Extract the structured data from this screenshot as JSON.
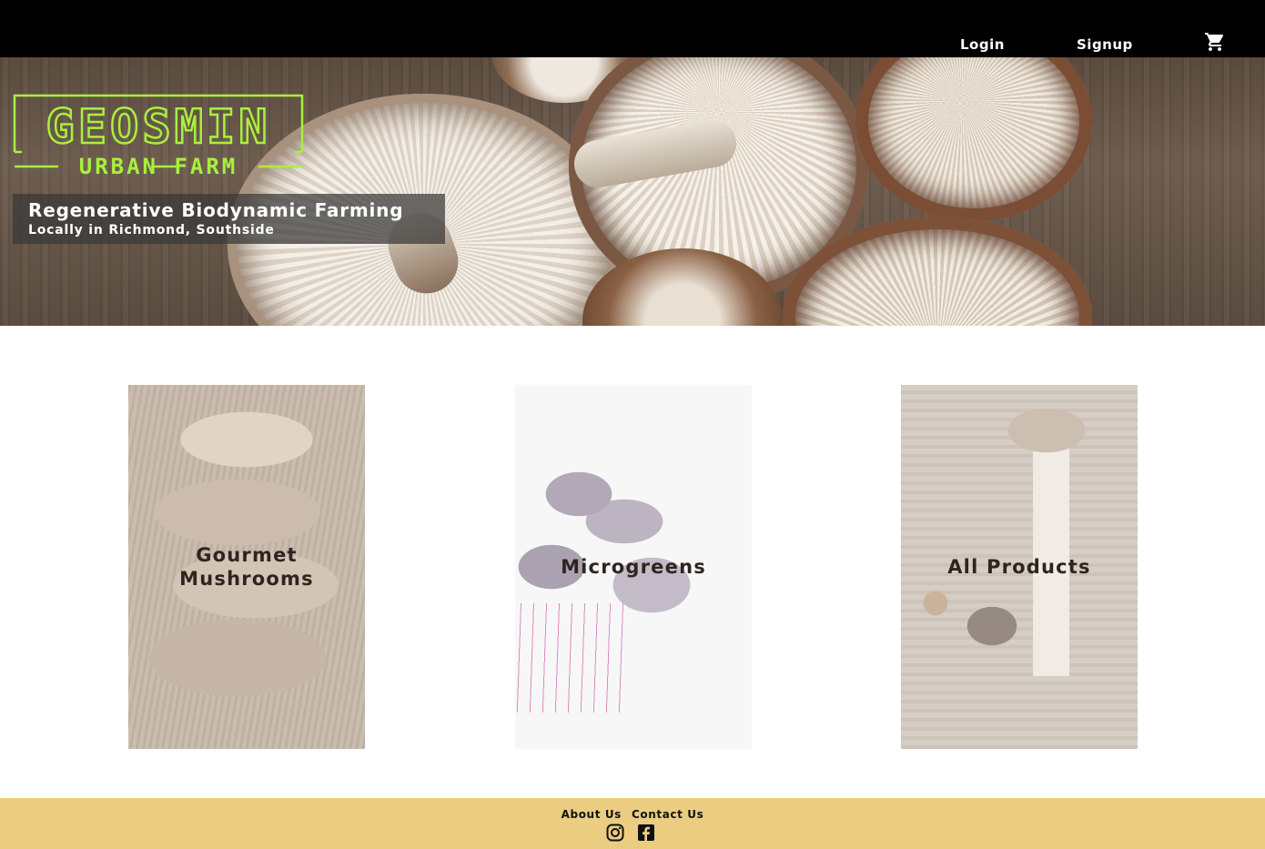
{
  "nav": {
    "login_label": "Login",
    "signup_label": "Signup",
    "cart_icon": "shopping-cart-icon"
  },
  "hero": {
    "logo": {
      "line1": "GEOSMIN",
      "line2": "URBAN FARM",
      "color": "#a8f03c"
    },
    "headline": "Regenerative Biodynamic Farming",
    "subheadline": "Locally in Richmond, Southside"
  },
  "categories": [
    {
      "label": "Gourmet Mushrooms"
    },
    {
      "label": "Microgreens"
    },
    {
      "label": "All Products"
    }
  ],
  "footer": {
    "links": [
      "About Us",
      "Contact Us"
    ],
    "social": [
      "instagram-icon",
      "facebook-icon"
    ],
    "background": "#ebcd82"
  },
  "colors": {
    "topbar": "#000000",
    "accent": "#a8f03c",
    "text_dark": "#2e2520"
  }
}
